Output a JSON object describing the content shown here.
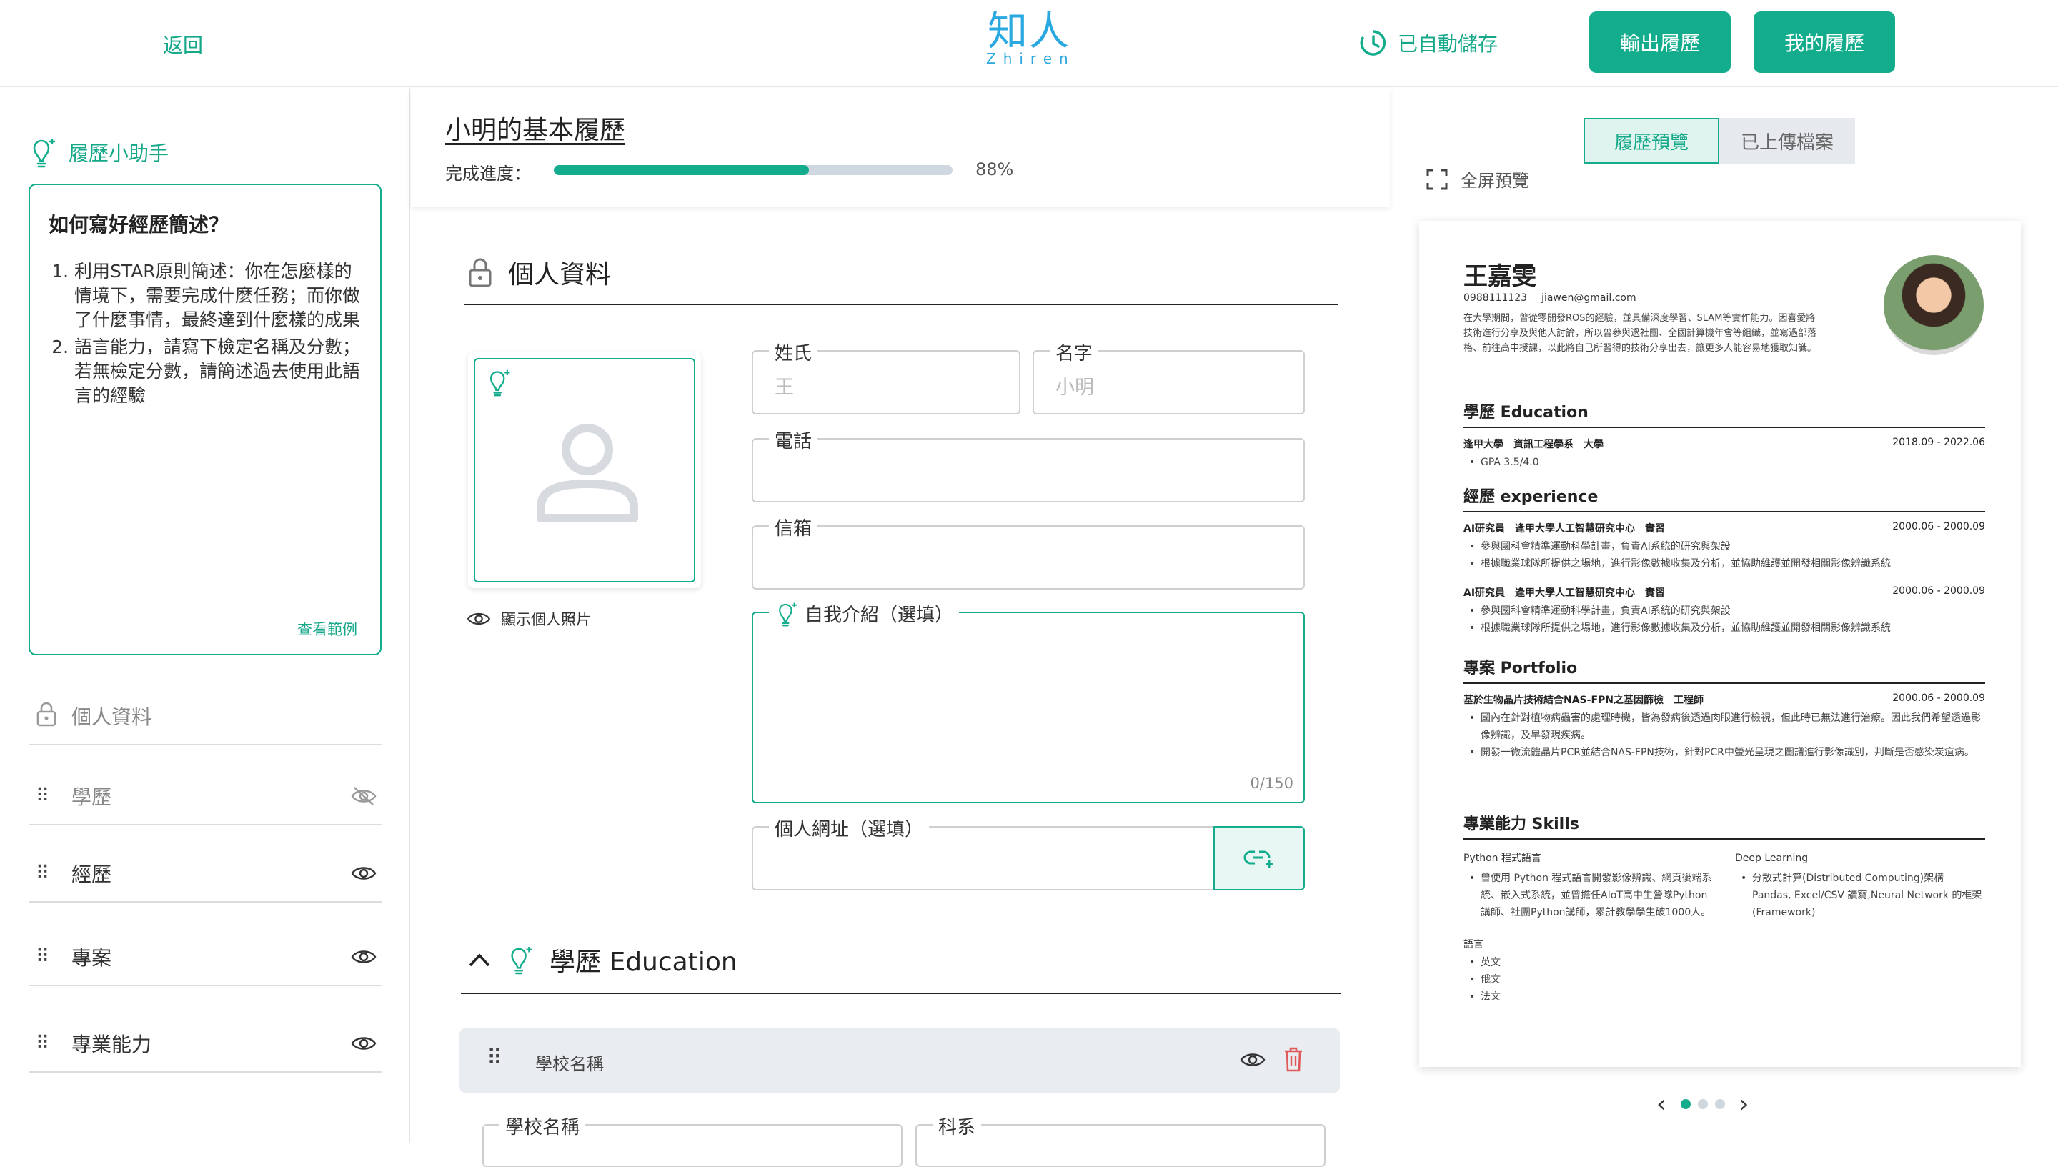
{
  "header": {
    "back_label": "返回",
    "logo_text": "知人",
    "logo_sub": "Zhiren",
    "autosave_label": "已自動儲存",
    "export_label": "輸出履歷",
    "my_resume_label": "我的履歷"
  },
  "assistant": {
    "title": "履歷小助手",
    "heading": "如何寫好經歷簡述？",
    "tips": [
      "利用STAR原則簡述：你在怎麼樣的情境下，需要完成什麼任務；而你做了什麼事情，最終達到什麼樣的成果",
      "語言能力，請寫下檢定名稱及分數；若無檢定分數，請簡述過去使用此語言的經驗"
    ],
    "see_example": "查看範例"
  },
  "sections": [
    {
      "label": "個人資料"
    },
    {
      "label": "學歷"
    },
    {
      "label": "經歷"
    },
    {
      "label": "專案"
    },
    {
      "label": "專業能力"
    }
  ],
  "resume": {
    "name": "小明的基本履歷",
    "progress_label": "完成進度：",
    "progress_value": "88%",
    "progress_fraction": 0.64
  },
  "personal": {
    "title": "個人資料",
    "show_photo": "顯示個人照片",
    "last_name_label": "姓氏",
    "last_name_placeholder": "王",
    "first_name_label": "名字",
    "first_name_placeholder": "小明",
    "phone_label": "電話",
    "email_label": "信箱",
    "intro_label": "自我介紹（選填）",
    "intro_count": "0/150",
    "website_label": "個人網址（選填）"
  },
  "education": {
    "title": "學歷 Education",
    "school_bar_label": "學校名稱",
    "school_label": "學校名稱",
    "dept_label": "科系"
  },
  "preview": {
    "tab_preview": "履歷預覽",
    "tab_uploaded": "已上傳檔案",
    "fullscreen": "全屏預覽",
    "name": "王嘉雯",
    "phone": "0988111123",
    "email": "jiawen@gmail.com",
    "summary": "在大學期間，曾從零開發ROS的經驗，並具備深度學習、SLAM等實作能力。因喜愛將技術進行分享及與他人討論，所以曾參與過社團、全國計算機年會等組織，並寫過部落格、前往高中授課，以此將自己所習得的技術分享出去，讓更多人能容易地獲取知識。",
    "edu_title": "學歷 Education",
    "edu_school": "逢甲大學　資訊工程學系　大學",
    "edu_date": "2018.09 - 2022.06",
    "edu_gpa": "GPA 3.5/4.0",
    "exp_title": "經歷 experience",
    "exp": [
      {
        "role": "AI研究員　逢甲大學人工智慧研究中心　實習",
        "date": "2000.06 - 2000.09",
        "bullets": [
          "參與國科會精準運動科學計畫，負責AI系統的研究與架設",
          "根據職業球隊所提供之場地，進行影像數據收集及分析，並協助維護並開發相關影像辨識系統"
        ]
      },
      {
        "role": "AI研究員　逢甲大學人工智慧研究中心　實習",
        "date": "2000.06 - 2000.09",
        "bullets": [
          "參與國科會精準運動科學計畫，負責AI系統的研究與架設",
          "根據職業球隊所提供之場地，進行影像數據收集及分析，並協助維護並開發相關影像辨識系統"
        ]
      }
    ],
    "proj_title": "專案 Portfolio",
    "proj_name": "基於生物晶片技術結合NAS-FPN之基因篩檢　工程師",
    "proj_date": "2000.06 - 2000.09",
    "proj_bullets": [
      "國內在針對植物病蟲害的處理時機，皆為發病後透過肉眼進行檢視，但此時已無法進行治療。因此我們希望透過影像辨識，及早發現疾病。",
      "開發一微流體晶片PCR並結合NAS-FPN技術，針對PCR中螢光呈現之圖譜進行影像識別，判斷是否感染炭疽病。"
    ],
    "skills_title": "專業能力 Skills",
    "skill1_name": "Python 程式語言",
    "skill1_desc": "曾使用 Python 程式語言開發影像辨識、網頁後端系統、嵌入式系統，並曾擔任AIoT高中生營隊Python講師、社團Python講師，累計教學學生破1000人。",
    "skill2_name": "Deep Learning",
    "skill2_desc": "分散式計算(Distributed Computing)架構 Pandas, Excel/CSV 讀寫,Neural Network 的框架(Framework)",
    "lang_name": "語言",
    "langs": [
      "英文",
      "俄文",
      "法文"
    ]
  },
  "colors": {
    "accent": "#13ac8c",
    "logo": "#2aa9e0"
  },
  "icons": [
    "clock-icon",
    "bulb-icon",
    "lock-icon",
    "drag-icon",
    "eye-icon",
    "eye-off-icon",
    "user-icon",
    "link-icon",
    "trash-icon",
    "chevron-up-icon",
    "fullscreen-icon",
    "chevron-left-icon",
    "chevron-right-icon"
  ]
}
